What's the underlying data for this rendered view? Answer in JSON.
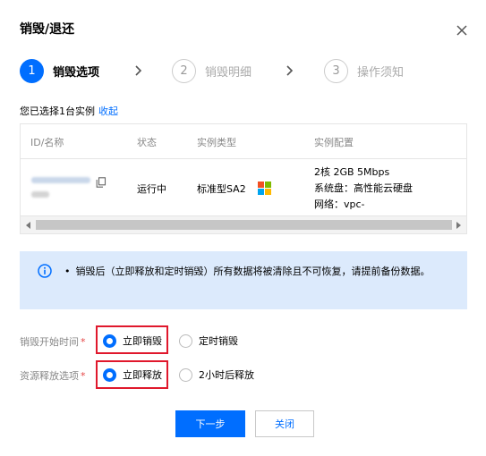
{
  "dialog": {
    "title": "销毁/退还"
  },
  "steps": [
    {
      "number": "1",
      "label": "销毁选项",
      "state": "active"
    },
    {
      "number": "2",
      "label": "销毁明细",
      "state": "inactive"
    },
    {
      "number": "3",
      "label": "操作须知",
      "state": "inactive"
    }
  ],
  "selection": {
    "text": "您已选择1台实例",
    "toggle_link": "收起"
  },
  "table": {
    "headers": [
      "ID/名称",
      "状态",
      "实例类型",
      "实例配置"
    ],
    "rows": [
      {
        "status": "运行中",
        "instance_type": "标准型SA2",
        "os_icon": "windows-icon",
        "config": [
          "2核 2GB 5Mbps",
          "系统盘：高性能云硬盘",
          "网络：vpc-"
        ]
      }
    ]
  },
  "notice": {
    "icon": "info-icon",
    "text": "销毁后（立即释放和定时销毁）所有数据将被清除且不可恢复，请提前备份数据。"
  },
  "form": {
    "destroy_time": {
      "label": "销毁开始时间",
      "required_mark": "*",
      "options": [
        "立即销毁",
        "定时销毁"
      ],
      "selected": "立即销毁"
    },
    "release_option": {
      "label": "资源释放选项",
      "required_mark": "*",
      "options": [
        "立即释放",
        "2小时后释放"
      ],
      "selected": "立即释放"
    }
  },
  "buttons": {
    "next": "下一步",
    "close": "关闭"
  },
  "colors": {
    "primary": "#006eff",
    "highlight_box": "#e0182c",
    "notice_bg": "#dceafc"
  }
}
